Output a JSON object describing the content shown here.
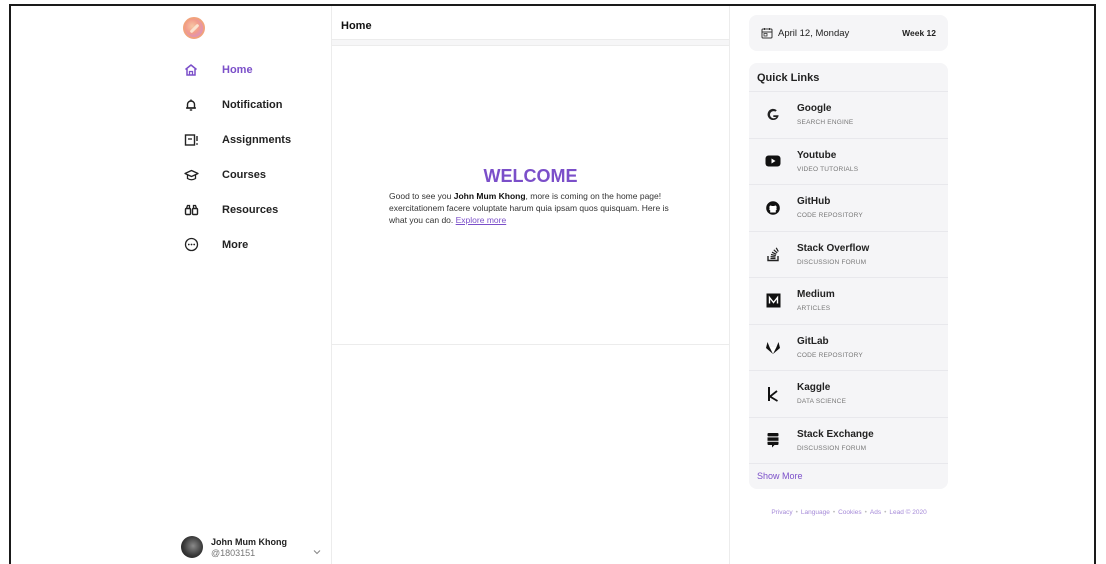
{
  "sidebar": {
    "logo": "app-logo",
    "items": [
      {
        "label": "Home",
        "icon": "home-icon"
      },
      {
        "label": "Notification",
        "icon": "bell-icon"
      },
      {
        "label": "Assignments",
        "icon": "assignment-icon"
      },
      {
        "label": "Courses",
        "icon": "graduation-cap-icon"
      },
      {
        "label": "Resources",
        "icon": "binoculars-icon"
      },
      {
        "label": "More",
        "icon": "more-circle-icon"
      }
    ],
    "active_item": "Home",
    "user": {
      "name": "John Mum Khong",
      "handle": "@1803151"
    }
  },
  "main": {
    "title": "Home",
    "welcome": {
      "heading": "WELCOME",
      "text_before": "Good to see you ",
      "name": "John Mum Khong",
      "text_after": ", more is coming on the home page! exercitationem facere voluptate harum quia ipsam quos quisquam. Here is what you can do. ",
      "link": "Explore more"
    }
  },
  "right": {
    "date": "April 12, Monday",
    "week": "Week 12",
    "quick_links_title": "Quick Links",
    "quick_links": [
      {
        "name": "Google",
        "desc": "SEARCH ENGINE",
        "icon": "google-icon"
      },
      {
        "name": "Youtube",
        "desc": "VIDEO TUTORIALS",
        "icon": "youtube-icon"
      },
      {
        "name": "GitHub",
        "desc": "CODE REPOSITORY",
        "icon": "github-icon"
      },
      {
        "name": "Stack Overflow",
        "desc": "DISCUSSION FORUM",
        "icon": "stackoverflow-icon"
      },
      {
        "name": "Medium",
        "desc": "ARTICLES",
        "icon": "medium-icon"
      },
      {
        "name": "GitLab",
        "desc": "CODE REPOSITORY",
        "icon": "gitlab-icon"
      },
      {
        "name": "Kaggle",
        "desc": "DATA SCIENCE",
        "icon": "kaggle-icon"
      },
      {
        "name": "Stack Exchange",
        "desc": "DISCUSSION FORUM",
        "icon": "stackexchange-icon"
      }
    ],
    "show_more": "Show More",
    "footer": [
      "Privacy",
      "Language",
      "Cookies",
      "Ads",
      "Lead © 2020"
    ],
    "footer_separator": "•"
  },
  "colors": {
    "accent": "#7b4fc9",
    "card_bg": "#f5f5f7",
    "text": "#222222"
  }
}
